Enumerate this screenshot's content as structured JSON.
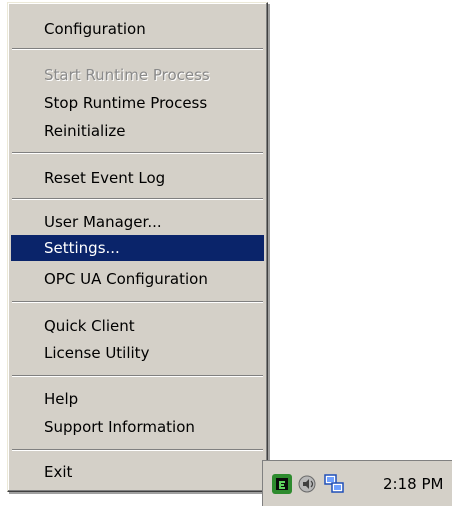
{
  "menu": {
    "items": [
      {
        "label": "Configuration"
      },
      {
        "label": "Start Runtime Process"
      },
      {
        "label": "Stop Runtime Process"
      },
      {
        "label": "Reinitialize"
      },
      {
        "label": "Reset Event Log"
      },
      {
        "label": "User Manager..."
      },
      {
        "label": "Settings..."
      },
      {
        "label": "OPC UA Configuration"
      },
      {
        "label": "Quick Client"
      },
      {
        "label": "License Utility"
      },
      {
        "label": "Help"
      },
      {
        "label": "Support Information"
      },
      {
        "label": "Exit"
      }
    ],
    "selected": "Settings...",
    "disabled": [
      "Start Runtime Process"
    ],
    "highlight_color": "#0a246a",
    "background_color": "#d4d0c8"
  },
  "tray": {
    "icons": [
      "kepserver-tray-icon",
      "audio-volume-icon",
      "network-connections-icon"
    ],
    "clock": "2:18 PM"
  }
}
